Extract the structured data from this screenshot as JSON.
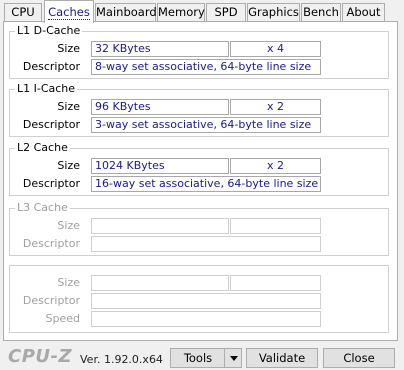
{
  "tabs": [
    {
      "label": "CPU"
    },
    {
      "label": "Caches"
    },
    {
      "label": "Mainboard"
    },
    {
      "label": "Memory"
    },
    {
      "label": "SPD"
    },
    {
      "label": "Graphics"
    },
    {
      "label": "Bench"
    },
    {
      "label": "About"
    }
  ],
  "active_tab": "Caches",
  "l1d": {
    "title": "L1 D-Cache",
    "size_label": "Size",
    "size": "32 KBytes",
    "count": "x 4",
    "descriptor_label": "Descriptor",
    "descriptor": "8-way set associative, 64-byte line size"
  },
  "l1i": {
    "title": "L1 I-Cache",
    "size_label": "Size",
    "size": "96 KBytes",
    "count": "x 2",
    "descriptor_label": "Descriptor",
    "descriptor": "3-way set associative, 64-byte line size"
  },
  "l2": {
    "title": "L2 Cache",
    "size_label": "Size",
    "size": "1024 KBytes",
    "count": "x 2",
    "descriptor_label": "Descriptor",
    "descriptor": "16-way set associative, 64-byte line size"
  },
  "l3": {
    "title": "L3 Cache",
    "size_label": "Size",
    "size": "",
    "count": "",
    "descriptor_label": "Descriptor",
    "descriptor": ""
  },
  "extra": {
    "size_label": "Size",
    "descriptor_label": "Descriptor",
    "speed_label": "Speed"
  },
  "footer": {
    "logo": "CPU-Z",
    "version": "Ver. 1.92.0.x64",
    "tools_label": "Tools",
    "validate_label": "Validate",
    "close_label": "Close"
  },
  "colors": {
    "value_text": "#1a1a8c",
    "disabled_text": "#a0a0a0"
  }
}
